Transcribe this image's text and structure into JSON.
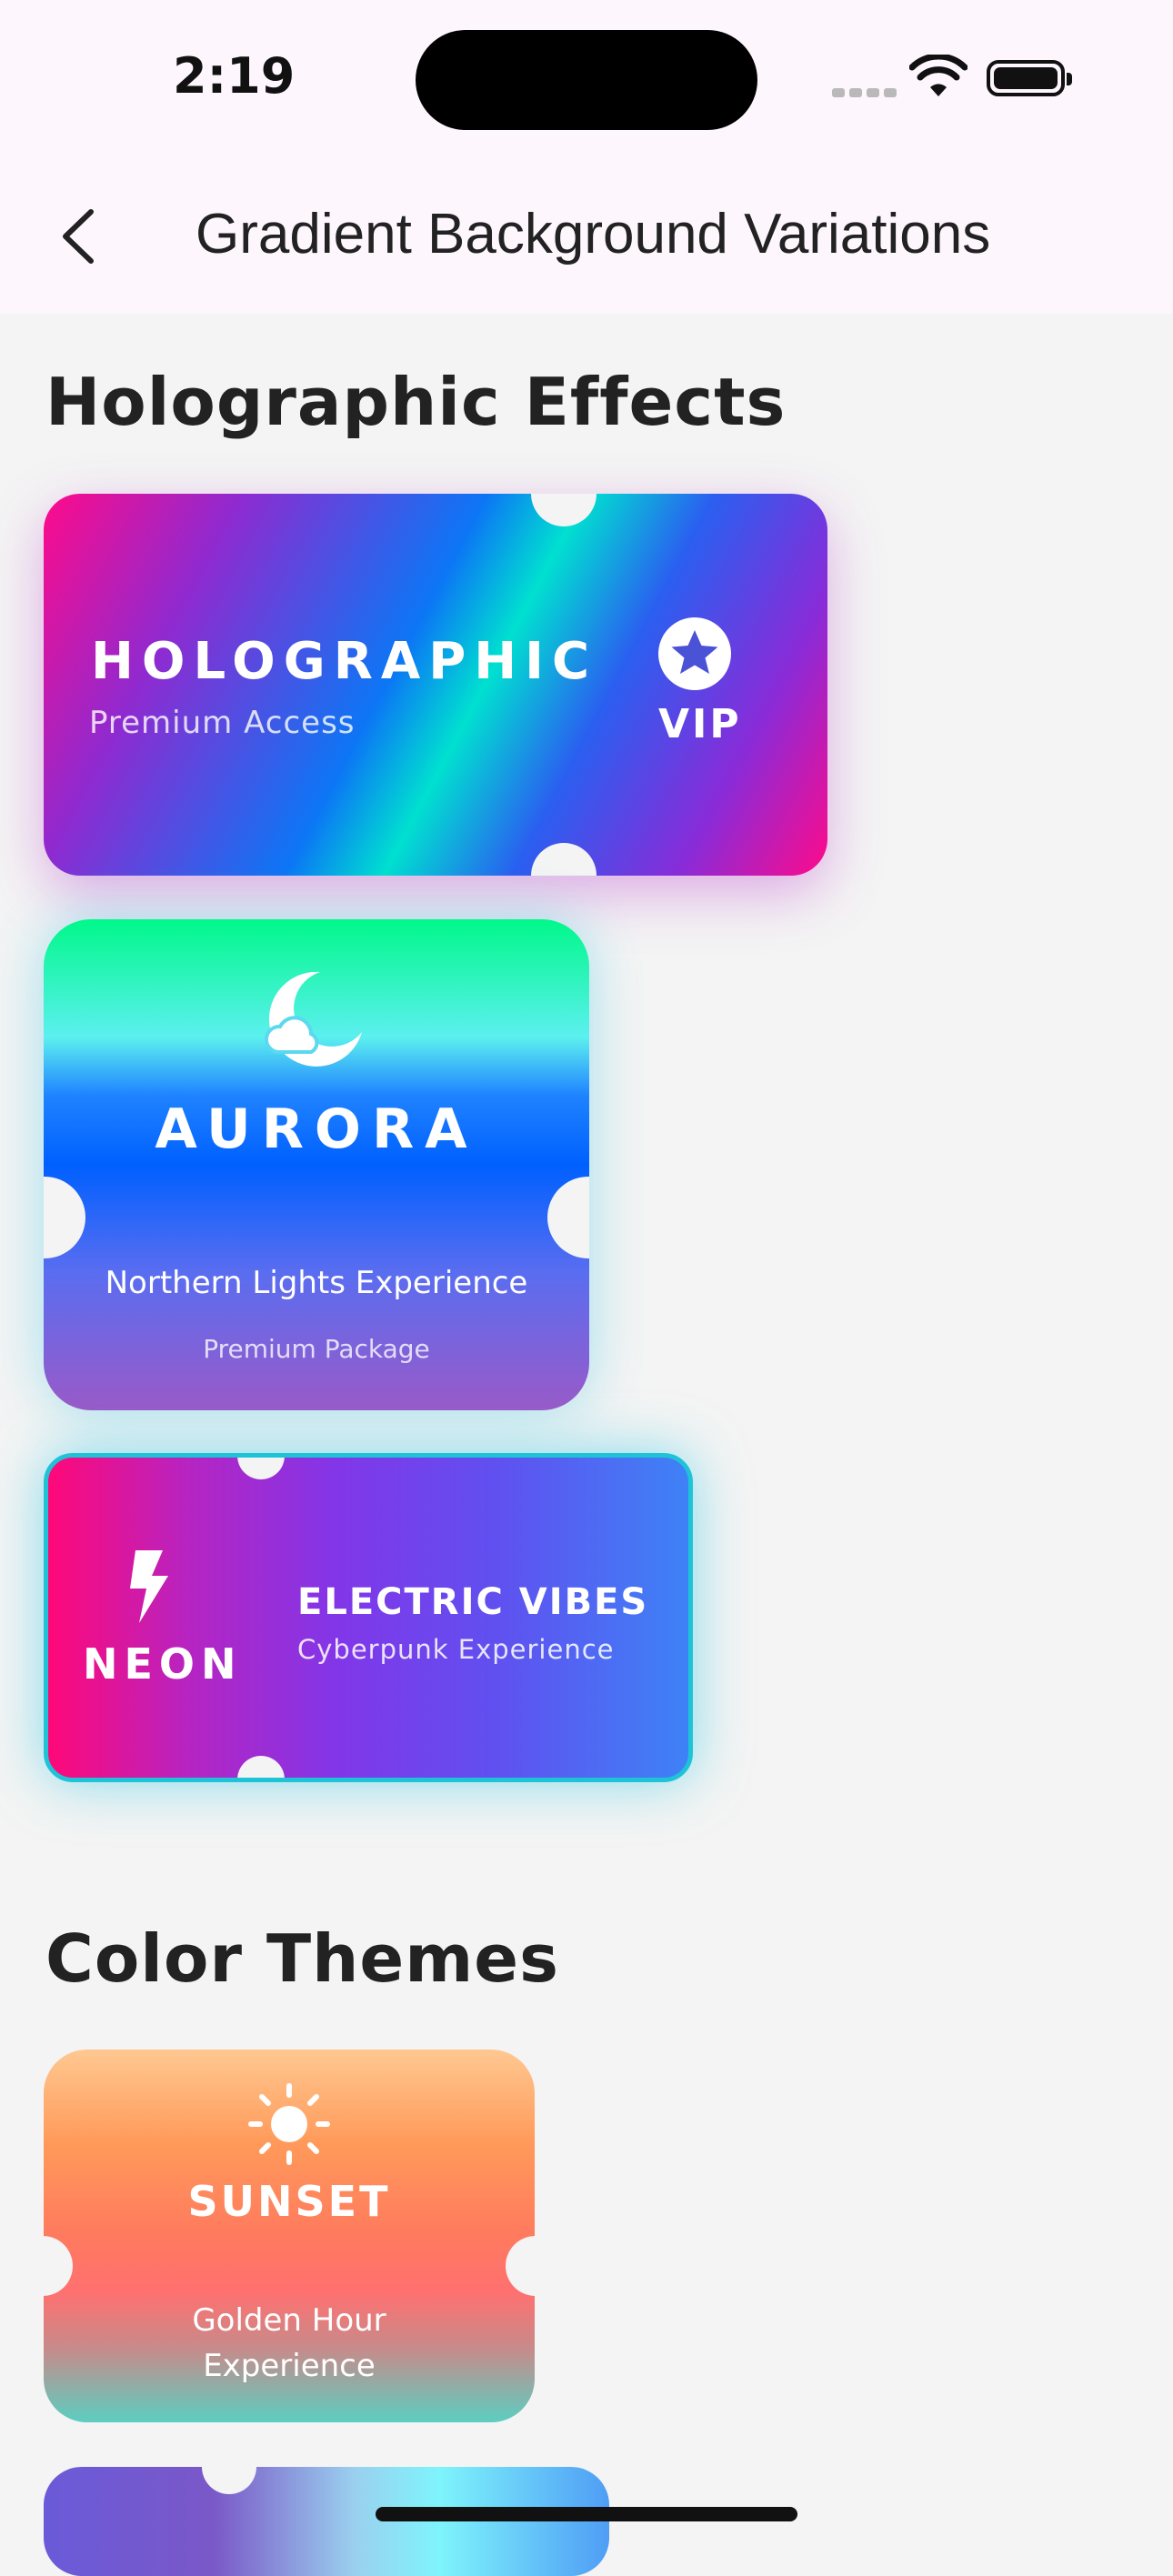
{
  "status_bar": {
    "time": "2:19"
  },
  "nav": {
    "title": "Gradient Background Variations",
    "back_icon": "chevron-left-icon"
  },
  "sections": {
    "holographic": "Holographic Effects",
    "color_themes": "Color Themes"
  },
  "cards": {
    "holographic": {
      "title": "HOLOGRAPHIC",
      "subtitle": "Premium Access",
      "badge": "VIP",
      "icon": "star-icon"
    },
    "aurora": {
      "title": "AURORA",
      "subtitle": "Northern Lights Experience",
      "detail": "Premium Package",
      "icon": "moon-cloud-icon"
    },
    "neon": {
      "label": "NEON",
      "title": "ELECTRIC VIBES",
      "subtitle": "Cyberpunk Experience",
      "icon": "lightning-icon"
    },
    "sunset": {
      "title": "SUNSET",
      "subtitle_line1": "Golden Hour",
      "subtitle_line2": "Experience",
      "icon": "sun-icon"
    }
  },
  "colors": {
    "background": "#f4f4f4",
    "header": "#fdf6fd",
    "neon_border": "#1fc3d8"
  }
}
